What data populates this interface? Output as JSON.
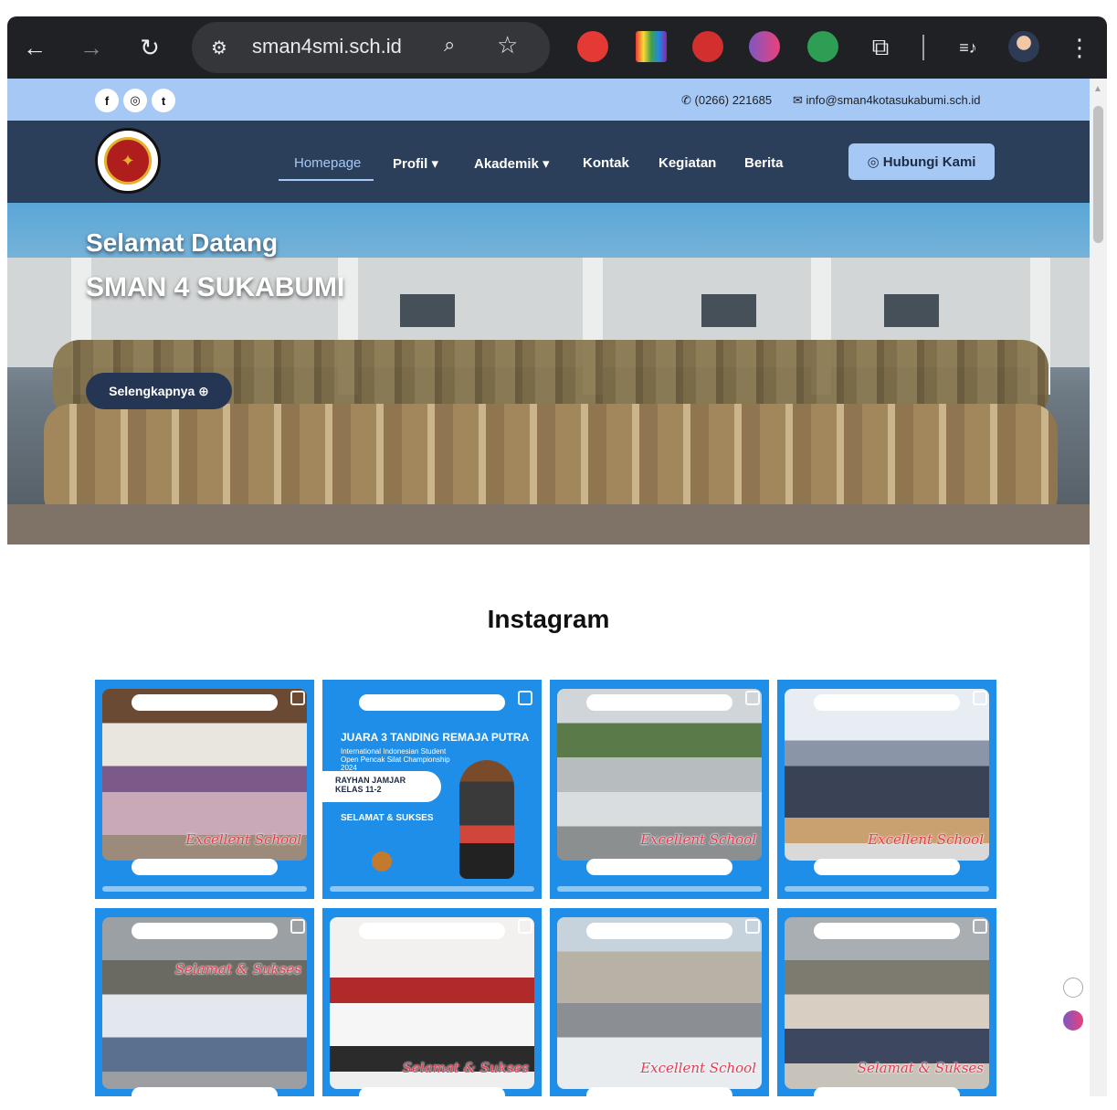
{
  "browser": {
    "url": "sman4smi.sch.id",
    "back_icon": "arrow-left-icon",
    "forward_icon": "arrow-right-icon",
    "reload_icon": "reload-icon",
    "back_glyph": "←",
    "forward_glyph": "→",
    "reload_glyph": "↻",
    "tune_glyph": "⚙",
    "zoom_glyph": "⌕",
    "star_glyph": "☆",
    "puzzle_glyph": "⧉",
    "media_glyph": "≡♪",
    "menu_glyph": "⋮"
  },
  "topbar": {
    "socials": [
      "f",
      "◎",
      "t"
    ],
    "phone": "✆ (0266) 221685",
    "email": "✉ info@sman4kotasukabumi.sch.id"
  },
  "nav": {
    "logo_glyph": "✦",
    "items": [
      "Homepage",
      "Profil ▾",
      "Akademik ▾",
      "Kontak",
      "Kegiatan",
      "Berita"
    ],
    "cta": "◎ Hubungi Kami"
  },
  "hero": {
    "title_line1": "Selamat Datang",
    "title_line2": "SMAN 4 SUKABUMI",
    "button": "Selengkapnya ⊕"
  },
  "instagram": {
    "heading": "Instagram",
    "posts": [
      {
        "script": "Excellent School"
      },
      {
        "title": "JUARA 3 TANDING REMAJA PUTRA",
        "subtitle": "International Indonesian Student Open Pencak Silat Championship 2024",
        "name": "RAYHAN JAMJAR KELAS 11-2",
        "congrats": "SELAMAT & SUKSES"
      },
      {
        "script": "Excellent School"
      },
      {
        "script": "Excellent School"
      },
      {
        "script": "Selamat & Sukses"
      },
      {
        "script": "Selamat & Sukses"
      },
      {
        "script": "Excellent School"
      },
      {
        "script": "Selamat & Sukses"
      }
    ]
  },
  "colors": {
    "topbar": "#a6c8f5",
    "navbar": "#2b3e5a",
    "instagram_card": "#1f8ee8"
  }
}
